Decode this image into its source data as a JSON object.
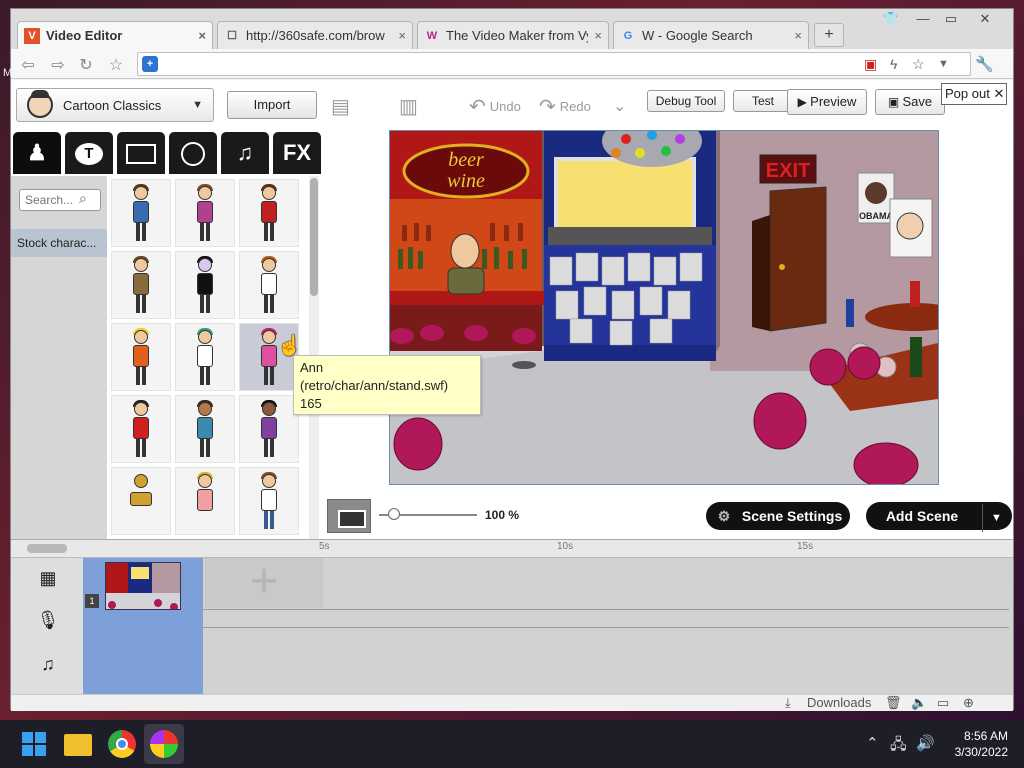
{
  "browser": {
    "tabs": [
      {
        "favicon": "V",
        "title": "Video Editor",
        "close": "×"
      },
      {
        "favicon": "☐",
        "title": "http://360safe.com/brow",
        "close": "×"
      },
      {
        "favicon": "W",
        "title": "The Video Maker from Vy",
        "close": "×"
      },
      {
        "favicon": "G",
        "title": "W - Google Search",
        "close": "×"
      }
    ],
    "new_tab": "+",
    "side_letter": "M"
  },
  "editor": {
    "theme_select": "Cartoon Classics",
    "import_label": "Import",
    "category_tabs": [
      "character",
      "speech",
      "backgrounds",
      "props",
      "music",
      "FX"
    ],
    "category_fx_label": "FX",
    "search_placeholder": "Search...",
    "library_category": "Stock charac...",
    "undo_label": "Undo",
    "redo_label": "Redo",
    "debug_label": "Debug Tool",
    "test_label": "Test",
    "preview_label": "Preview",
    "save_label": "Save",
    "popout_label": "Pop out",
    "tooltip": {
      "name": "Ann",
      "path": "(retro/char/ann/stand.swf)",
      "id": "165"
    },
    "zoom_label": "100 %",
    "zoom_value": 0.15,
    "scene_settings_label": "Scene Settings",
    "add_scene_label": "Add Scene",
    "stage_signs": {
      "beer": "beer",
      "wine": "wine",
      "exit": "EXIT",
      "poster": "OBAMA"
    },
    "timeline": {
      "ticks": [
        "5s",
        "10s",
        "15s"
      ],
      "scene_number": "1",
      "add_slot": "+"
    },
    "status": {
      "downloads": "Downloads"
    }
  },
  "taskbar": {
    "time": "8:56 AM",
    "date": "3/30/2022"
  },
  "colors": {
    "stage_border": "#6a8ab0",
    "scene_selected": "#7ea0d8",
    "tooltip_bg": "#ffffc8",
    "pill_bg": "#111111"
  }
}
